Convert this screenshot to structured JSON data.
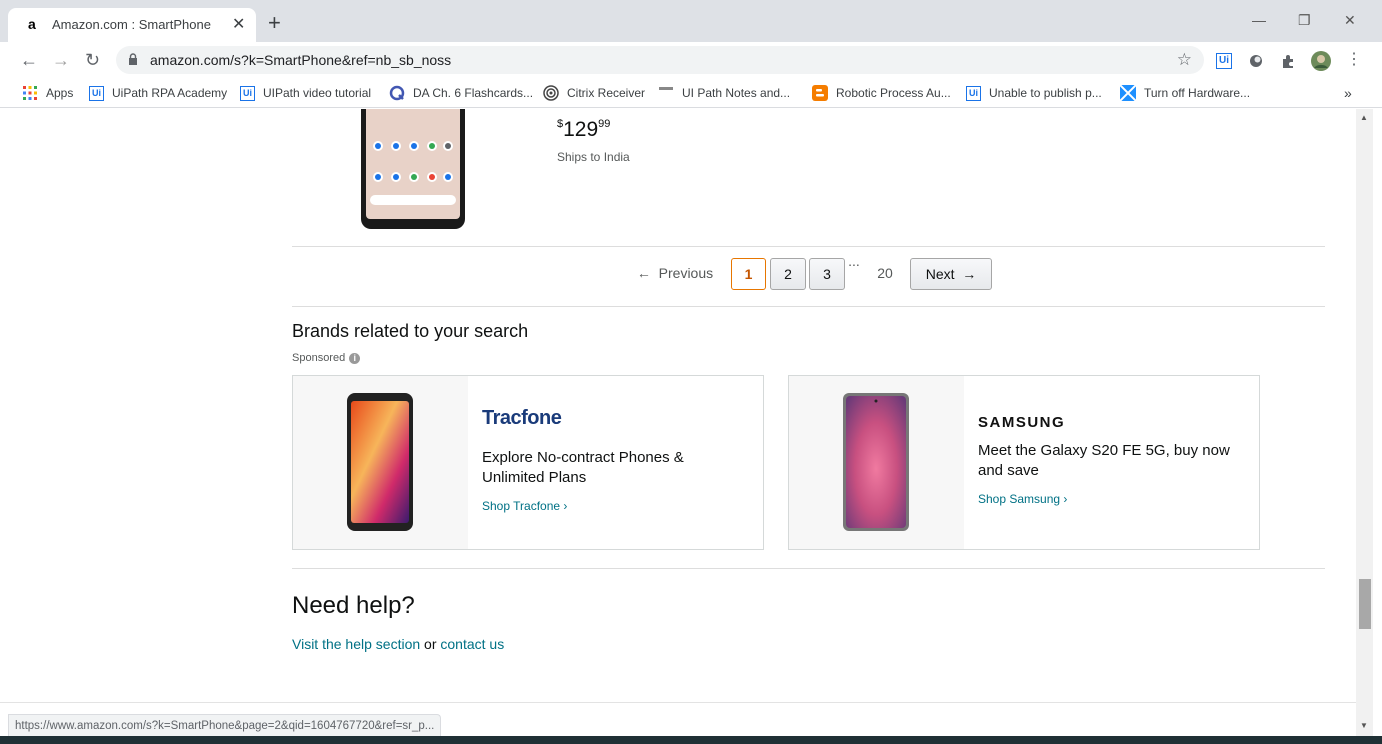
{
  "browser": {
    "tab_title": "Amazon.com : SmartPhone",
    "tab_close": "✕",
    "new_tab": "+",
    "url": "amazon.com/s?k=SmartPhone&ref=nb_sb_noss",
    "status_url": "https://www.amazon.com/s?k=SmartPhone&page=2&qid=1604767720&ref=sr_p..."
  },
  "bookmarks": [
    {
      "label": "Apps",
      "icon": "apps-grid-icon"
    },
    {
      "label": "UiPath RPA Academy",
      "icon": "uipath-icon"
    },
    {
      "label": "UIPath video tutorial",
      "icon": "uipath-icon"
    },
    {
      "label": "DA Ch. 6 Flashcards...",
      "icon": "quizlet-icon"
    },
    {
      "label": "Citrix Receiver",
      "icon": "citrix-icon"
    },
    {
      "label": "UI Path Notes and...",
      "icon": "doc-icon"
    },
    {
      "label": "Robotic Process Au...",
      "icon": "blogger-icon"
    },
    {
      "label": "Unable to publish p...",
      "icon": "uipath-icon"
    },
    {
      "label": "Turn off Hardware...",
      "icon": "windows-icon"
    }
  ],
  "bookmarks_overflow": "»",
  "product": {
    "price_symbol": "$",
    "price_whole": "129",
    "price_fraction": "99",
    "shipping": "Ships to India"
  },
  "pagination": {
    "previous": "Previous",
    "pages": [
      "1",
      "2",
      "3"
    ],
    "ellipsis": "...",
    "last": "20",
    "next": "Next",
    "current": "1"
  },
  "brands": {
    "heading": "Brands related to your search",
    "sponsored": "Sponsored",
    "cards": [
      {
        "brand": "Tracfone",
        "text": "Explore No-contract Phones & Unlimited Plans",
        "link": "Shop Tracfone"
      },
      {
        "brand": "SAMSUNG",
        "text": "Meet the Galaxy S20 FE 5G, buy now and save",
        "link": "Shop Samsung"
      }
    ]
  },
  "help": {
    "heading": "Need help?",
    "visit_link": "Visit the help section",
    "or": "or",
    "contact_link": "contact us"
  },
  "colors": {
    "link": "#007185",
    "current_page_border": "#e77600",
    "tab_strip": "#dee1e6"
  }
}
